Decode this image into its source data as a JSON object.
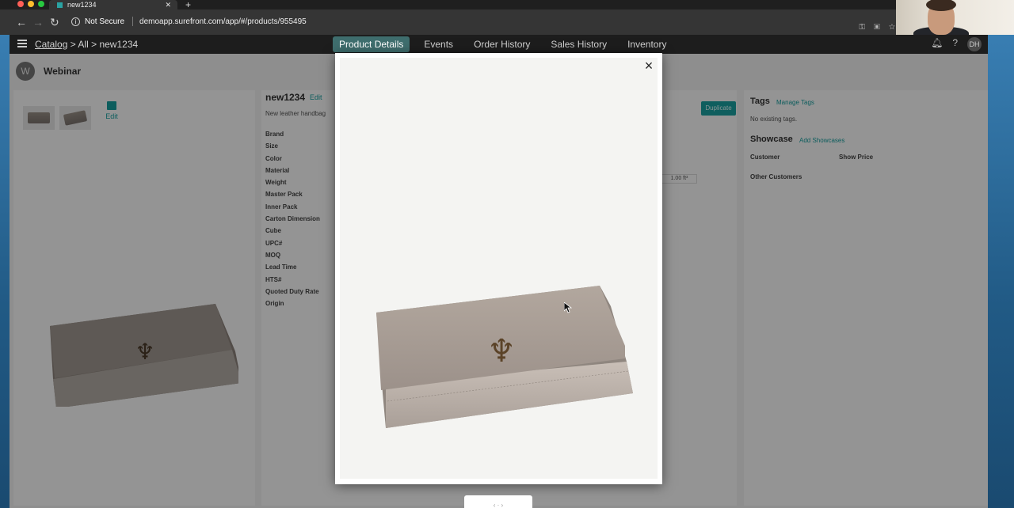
{
  "browser": {
    "tab_title": "new1234",
    "security_label": "Not Secure",
    "url": "demoapp.surefront.com/app/#/products/955495"
  },
  "app": {
    "breadcrumb": {
      "root": "Catalog",
      "sep1": ">",
      "level1": "All",
      "sep2": ">",
      "current": "new1234"
    },
    "tabs": [
      {
        "label": "Product Details"
      },
      {
        "label": "Events"
      },
      {
        "label": "Order History"
      },
      {
        "label": "Sales History"
      },
      {
        "label": "Inventory"
      }
    ],
    "user_initials": "DH",
    "workspace": {
      "initial": "W",
      "name": "Webinar"
    }
  },
  "product": {
    "name": "new1234",
    "edit_label": "Edit",
    "description": "New leather handbag",
    "duplicate_label": "Duplicate",
    "dimension_value": "1.00 ft³",
    "image_edit_label": "Edit",
    "attributes": [
      "Brand",
      "Size",
      "Color",
      "Material",
      "Weight",
      "Master Pack",
      "Inner Pack",
      "Carton Dimension",
      "Cube",
      "UPC#",
      "MOQ",
      "Lead Time",
      "HTS#",
      "Quoted Duty Rate",
      "Origin"
    ]
  },
  "sidebar": {
    "tags_heading": "Tags",
    "manage_tags": "Manage Tags",
    "no_tags": "No existing tags.",
    "showcase_heading": "Showcase",
    "add_showcases": "Add Showcases",
    "customer_label": "Customer",
    "show_price_label": "Show Price",
    "other_customers": "Other Customers"
  },
  "modal": {
    "close_symbol": "×"
  },
  "colors": {
    "accent": "#16a0a0",
    "active_tab": "#3f6e6e",
    "app_bar": "#1d1d1d"
  }
}
